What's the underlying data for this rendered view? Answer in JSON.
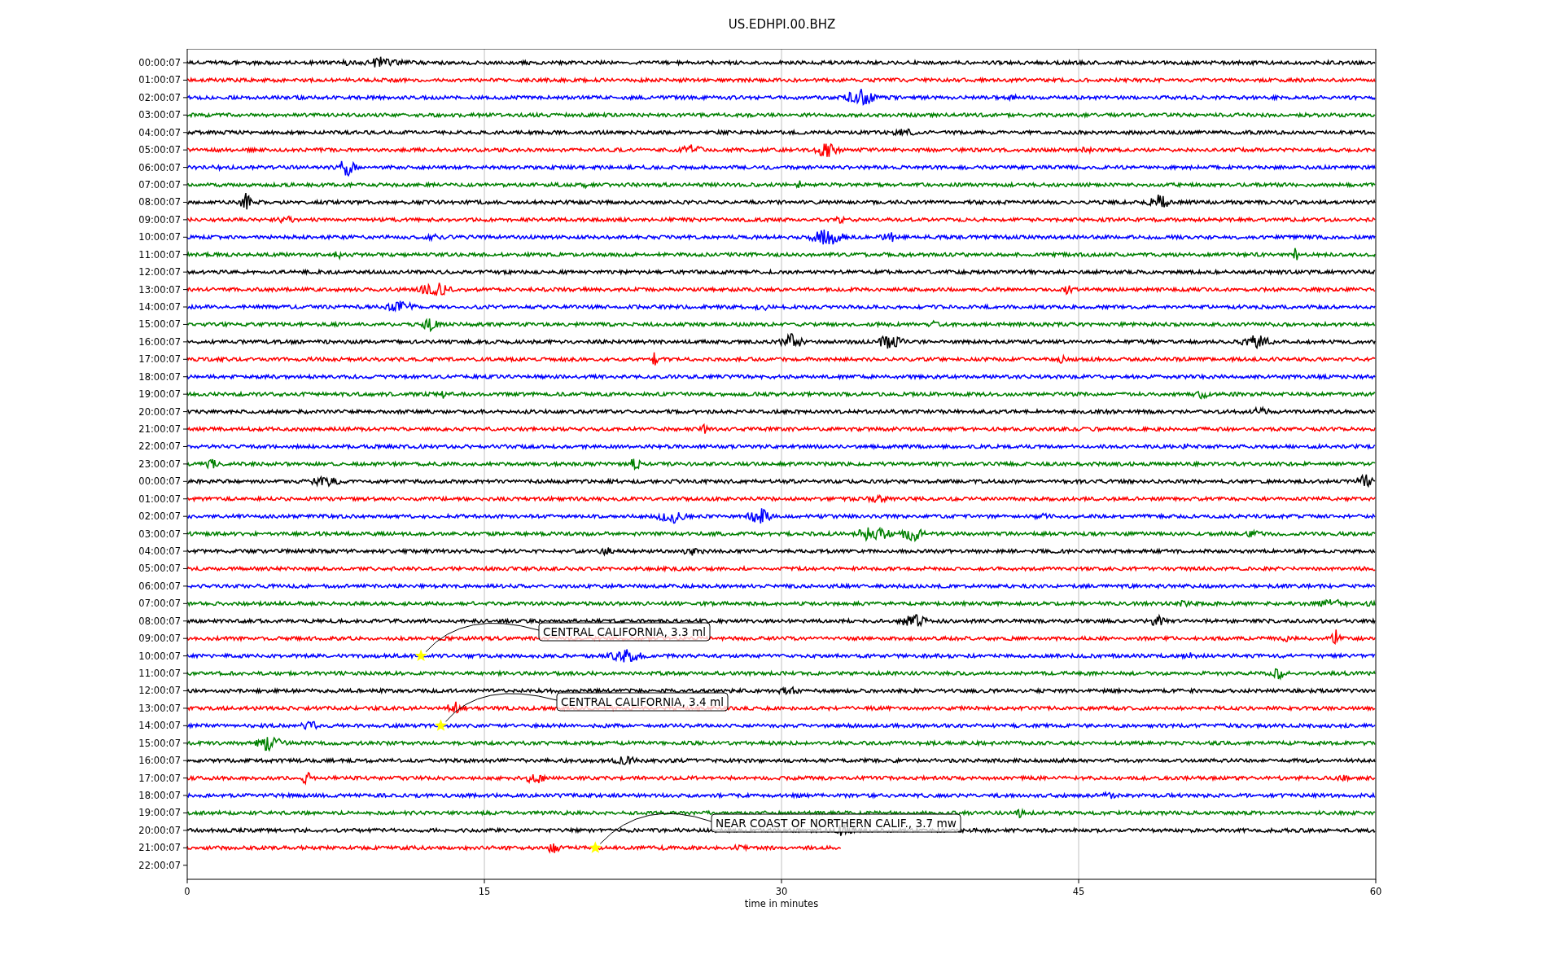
{
  "title": "US.EDHPI.00.BHZ",
  "xlabel": "time in minutes",
  "xticks": [
    "0",
    "15",
    "30",
    "45",
    "60"
  ],
  "rows": [
    {
      "label": "00:00:07",
      "kind": "trace",
      "color": "#000000"
    },
    {
      "label": "01:00:07",
      "kind": "trace",
      "color": "#ff0000"
    },
    {
      "label": "02:00:07",
      "kind": "trace",
      "color": "#0000ff"
    },
    {
      "label": "03:00:07",
      "kind": "trace",
      "color": "#008000"
    },
    {
      "label": "04:00:07",
      "kind": "trace",
      "color": "#000000"
    },
    {
      "label": "05:00:07",
      "kind": "trace",
      "color": "#ff0000"
    },
    {
      "label": "06:00:07",
      "kind": "trace",
      "color": "#0000ff"
    },
    {
      "label": "07:00:07",
      "kind": "trace",
      "color": "#008000"
    },
    {
      "label": "08:00:07",
      "kind": "trace",
      "color": "#000000"
    },
    {
      "label": "09:00:07",
      "kind": "trace",
      "color": "#ff0000"
    },
    {
      "label": "10:00:07",
      "kind": "trace",
      "color": "#0000ff"
    },
    {
      "label": "11:00:07",
      "kind": "trace",
      "color": "#008000"
    },
    {
      "label": "12:00:07",
      "kind": "trace",
      "color": "#000000"
    },
    {
      "label": "13:00:07",
      "kind": "trace",
      "color": "#ff0000"
    },
    {
      "label": "14:00:07",
      "kind": "trace",
      "color": "#0000ff"
    },
    {
      "label": "15:00:07",
      "kind": "trace",
      "color": "#008000"
    },
    {
      "label": "16:00:07",
      "kind": "trace",
      "color": "#000000"
    },
    {
      "label": "17:00:07",
      "kind": "trace",
      "color": "#ff0000"
    },
    {
      "label": "18:00:07",
      "kind": "trace",
      "color": "#0000ff"
    },
    {
      "label": "19:00:07",
      "kind": "trace",
      "color": "#008000"
    },
    {
      "label": "20:00:07",
      "kind": "trace",
      "color": "#000000"
    },
    {
      "label": "21:00:07",
      "kind": "trace",
      "color": "#ff0000"
    },
    {
      "label": "22:00:07",
      "kind": "trace",
      "color": "#0000ff"
    },
    {
      "label": "23:00:07",
      "kind": "trace",
      "color": "#008000"
    },
    {
      "label": "00:00:07",
      "kind": "trace",
      "color": "#000000"
    },
    {
      "label": "01:00:07",
      "kind": "trace",
      "color": "#ff0000"
    },
    {
      "label": "02:00:07",
      "kind": "trace",
      "color": "#0000ff"
    },
    {
      "label": "03:00:07",
      "kind": "trace",
      "color": "#008000"
    },
    {
      "label": "04:00:07",
      "kind": "trace",
      "color": "#000000"
    },
    {
      "label": "05:00:07",
      "kind": "trace",
      "color": "#ff0000"
    },
    {
      "label": "06:00:07",
      "kind": "trace",
      "color": "#0000ff"
    },
    {
      "label": "07:00:07",
      "kind": "trace",
      "color": "#008000"
    },
    {
      "label": "08:00:07",
      "kind": "trace",
      "color": "#000000"
    },
    {
      "label": "09:00:07",
      "kind": "trace",
      "color": "#ff0000"
    },
    {
      "label": "10:00:07",
      "kind": "trace",
      "color": "#0000ff"
    },
    {
      "label": "11:00:07",
      "kind": "trace",
      "color": "#008000"
    },
    {
      "label": "12:00:07",
      "kind": "trace",
      "color": "#000000"
    },
    {
      "label": "13:00:07",
      "kind": "trace",
      "color": "#ff0000"
    },
    {
      "label": "14:00:07",
      "kind": "trace",
      "color": "#0000ff"
    },
    {
      "label": "15:00:07",
      "kind": "trace",
      "color": "#008000"
    },
    {
      "label": "16:00:07",
      "kind": "trace",
      "color": "#000000"
    },
    {
      "label": "17:00:07",
      "kind": "trace",
      "color": "#ff0000"
    },
    {
      "label": "18:00:07",
      "kind": "trace",
      "color": "#0000ff"
    },
    {
      "label": "19:00:07",
      "kind": "trace",
      "color": "#008000"
    },
    {
      "label": "20:00:07",
      "kind": "trace",
      "color": "#000000"
    },
    {
      "label": "21:00:07",
      "kind": "trace",
      "color": "#ff0000",
      "level": 0.55
    },
    {
      "label": "22:00:07",
      "kind": "empty"
    }
  ],
  "events": [
    {
      "text": "CENTRAL CALIFORNIA, 3.3 ml"
    },
    {
      "text": "CENTRAL CALIFORNIA, 3.4 ml"
    },
    {
      "text": "NEAR COAST OF NORTHERN CALIF., 3.7 mw"
    }
  ]
}
